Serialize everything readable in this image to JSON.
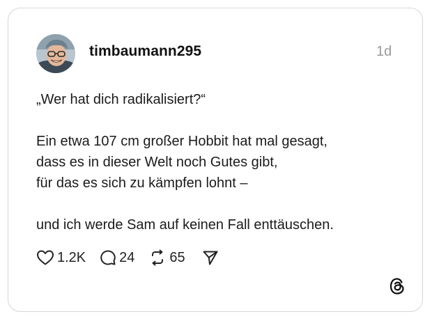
{
  "post": {
    "username": "timbaumann295",
    "time": "1d",
    "avatar_icon": "avatar-photo",
    "lines": [
      "„Wer hat dich radikalisiert?“",
      "",
      "Ein etwa 107 cm großer Hobbit hat mal gesagt,",
      "dass es in dieser Welt noch Gutes gibt,",
      "für das es sich zu kämpfen lohnt –",
      "",
      "und ich werde Sam auf keinen Fall enttäuschen."
    ]
  },
  "actions": {
    "likes": "1.2K",
    "replies": "24",
    "reposts": "65",
    "like_icon": "heart-icon",
    "reply_icon": "comment-icon",
    "repost_icon": "repost-icon",
    "share_icon": "send-icon"
  },
  "brand": {
    "logo_icon": "threads-logo",
    "colors": {
      "text": "#1b1b1b",
      "muted": "#9a9a9a",
      "border": "#d6d6d6"
    }
  }
}
